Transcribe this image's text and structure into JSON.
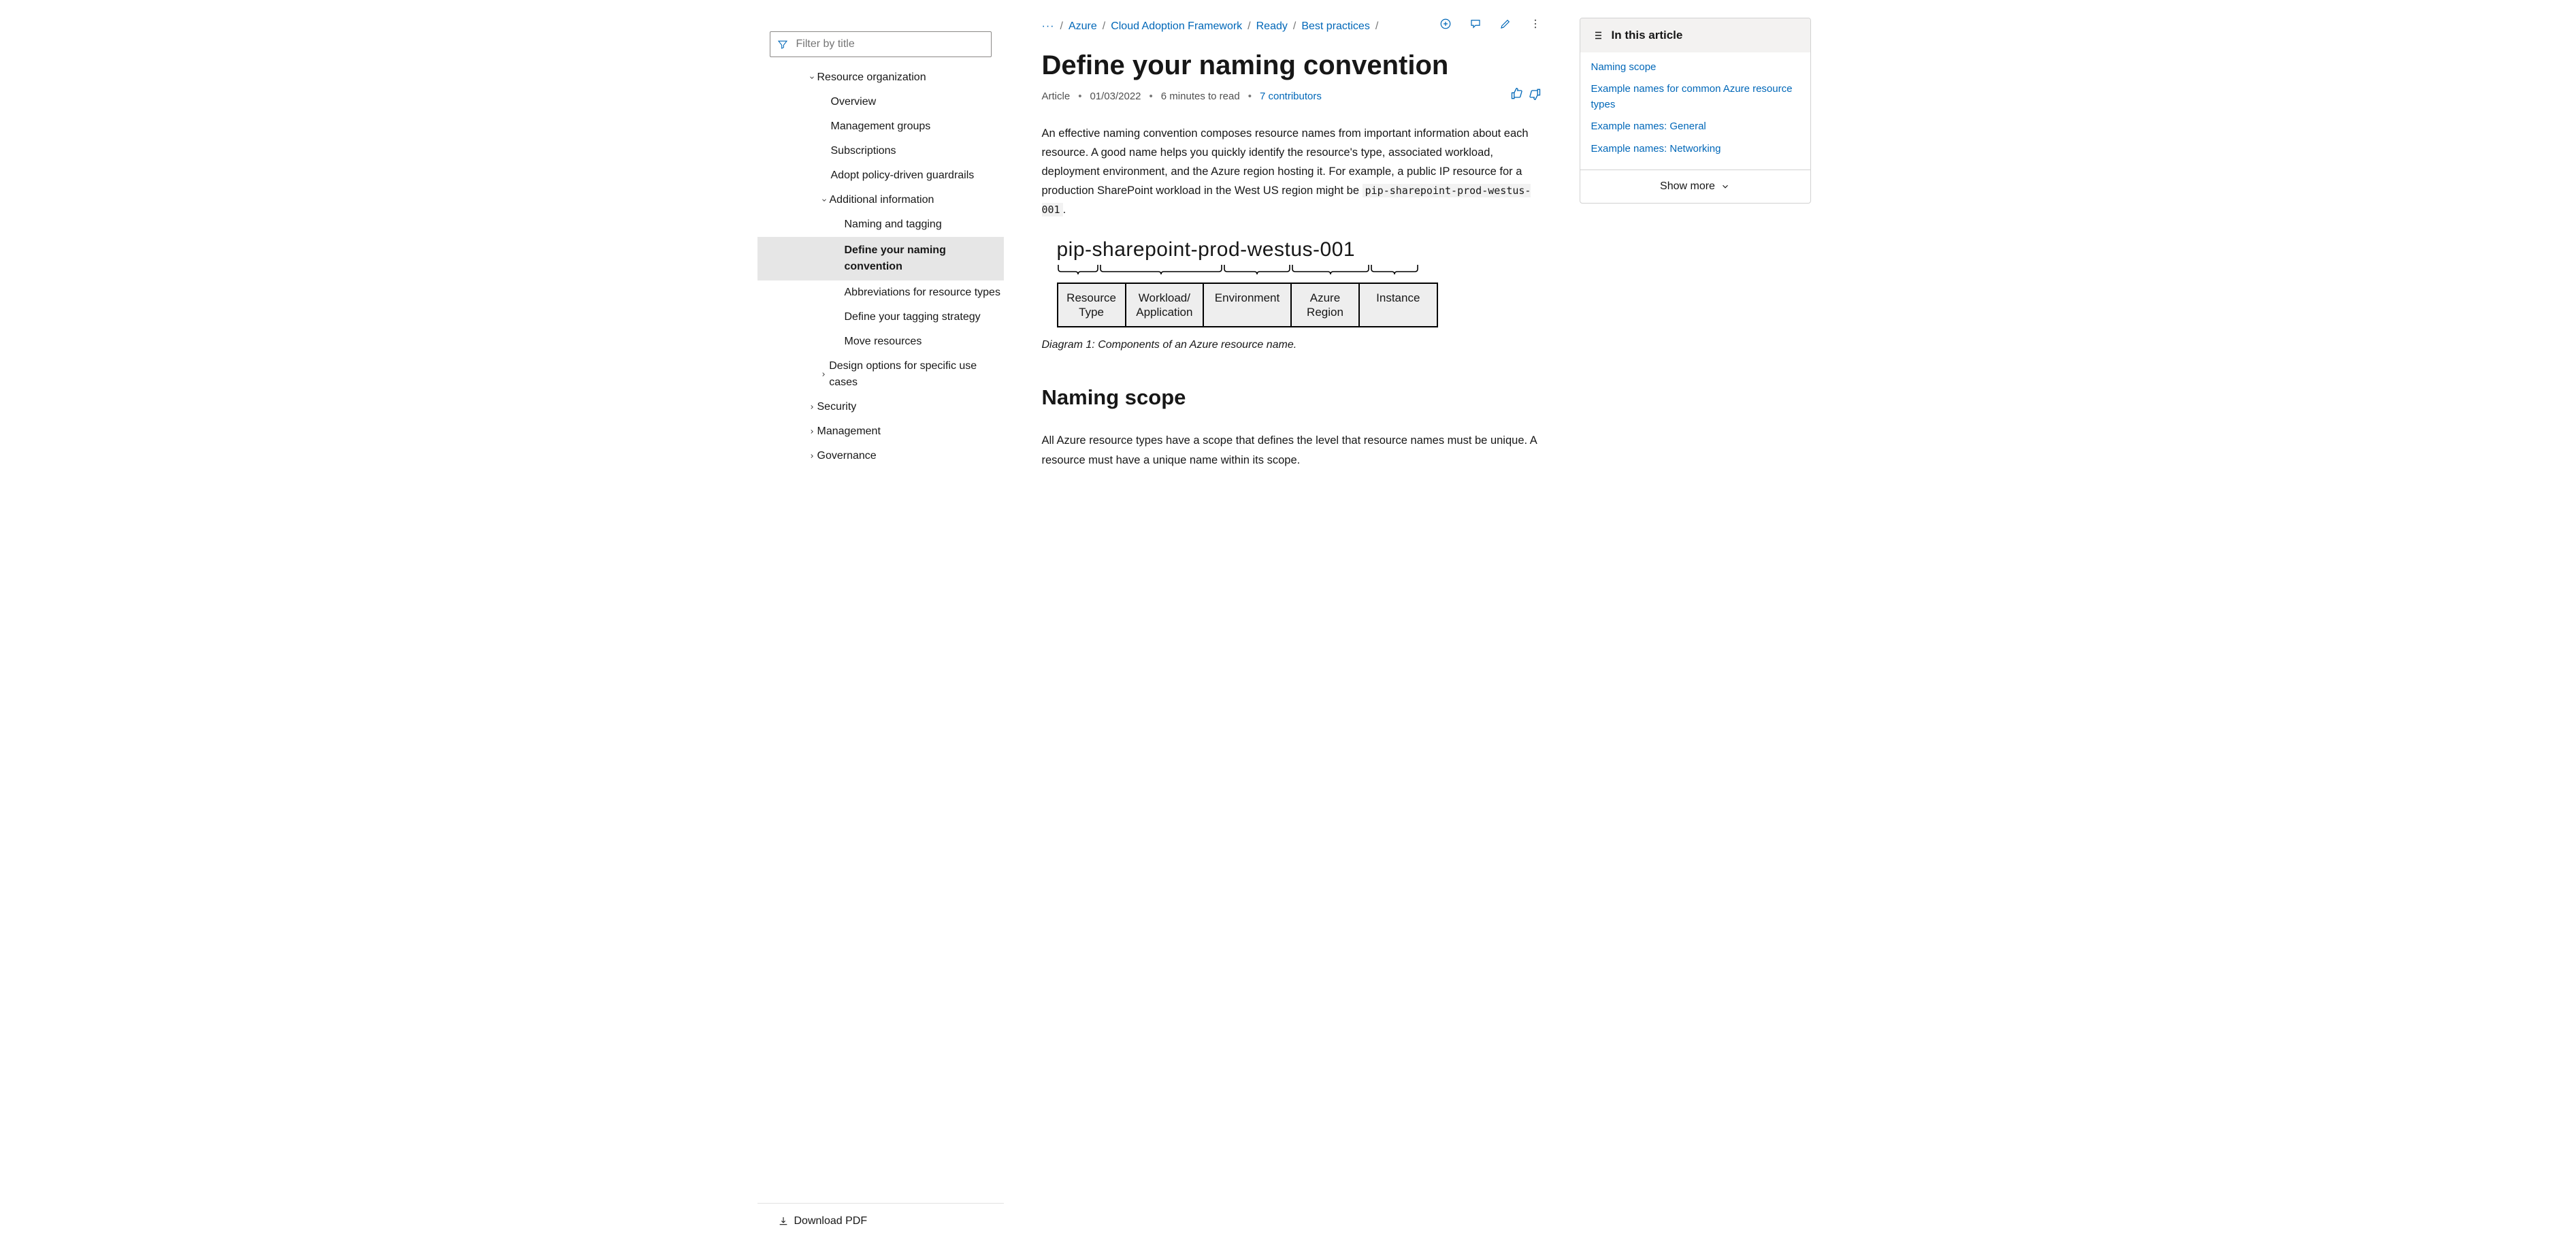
{
  "sidebar": {
    "filter_placeholder": "Filter by title",
    "items": [
      {
        "level": 1,
        "label": "Resource organization",
        "expandable": true,
        "open": true
      },
      {
        "level": 2,
        "label": "Overview"
      },
      {
        "level": 2,
        "label": "Management groups"
      },
      {
        "level": 2,
        "label": "Subscriptions"
      },
      {
        "level": 2,
        "label": "Adopt policy-driven guardrails"
      },
      {
        "level": 2,
        "label": "Additional information",
        "expandable": true,
        "open": true
      },
      {
        "level": 3,
        "label": "Naming and tagging"
      },
      {
        "level": 3,
        "label": "Define your naming convention",
        "selected": true
      },
      {
        "level": 3,
        "label": "Abbreviations for resource types"
      },
      {
        "level": 3,
        "label": "Define your tagging strategy"
      },
      {
        "level": 3,
        "label": "Move resources"
      },
      {
        "level": 2,
        "label": "Design options for specific use cases",
        "expandable": true,
        "open": false
      },
      {
        "level": 1,
        "label": "Security",
        "expandable": true,
        "open": false
      },
      {
        "level": 1,
        "label": "Management",
        "expandable": true,
        "open": false
      },
      {
        "level": 1,
        "label": "Governance",
        "expandable": true,
        "open": false
      }
    ],
    "download": "Download PDF"
  },
  "breadcrumbs": {
    "ellipsis": "···",
    "items": [
      "Azure",
      "Cloud Adoption Framework",
      "Ready",
      "Best practices"
    ]
  },
  "article": {
    "title": "Define your naming convention",
    "kind": "Article",
    "date": "01/03/2022",
    "readtime": "6 minutes to read",
    "contributors": "7 contributors",
    "p1_a": "An effective naming convention composes resource names from important information about each resource. A good name helps you quickly identify the resource's type, associated workload, deployment environment, and the Azure region hosting it. For example, a public IP resource for a production SharePoint workload in the West US region might be ",
    "p1_code": "pip-sharepoint-prod-westus-001",
    "p1_b": ".",
    "h2": "Naming scope",
    "p2": "All Azure resource types have a scope that defines the level that resource names must be unique. A resource must have a unique name within its scope.",
    "caption": "Diagram 1: Components of an Azure resource name."
  },
  "diagram": {
    "name": "pip-sharepoint-prod-westus-001",
    "parts": [
      {
        "label": "Resource Type",
        "w": 96
      },
      {
        "label": "Workload/ Application",
        "w": 112
      },
      {
        "label": "Environment",
        "w": 128
      },
      {
        "label": "Azure Region",
        "w": 96
      },
      {
        "label": "Instance",
        "w": 112
      }
    ],
    "braces": [
      62,
      182,
      100,
      116,
      72
    ]
  },
  "rail": {
    "heading": "In this article",
    "links": [
      "Naming scope",
      "Example names for common Azure resource types",
      "Example names: General",
      "Example names: Networking"
    ],
    "show_more": "Show more"
  }
}
